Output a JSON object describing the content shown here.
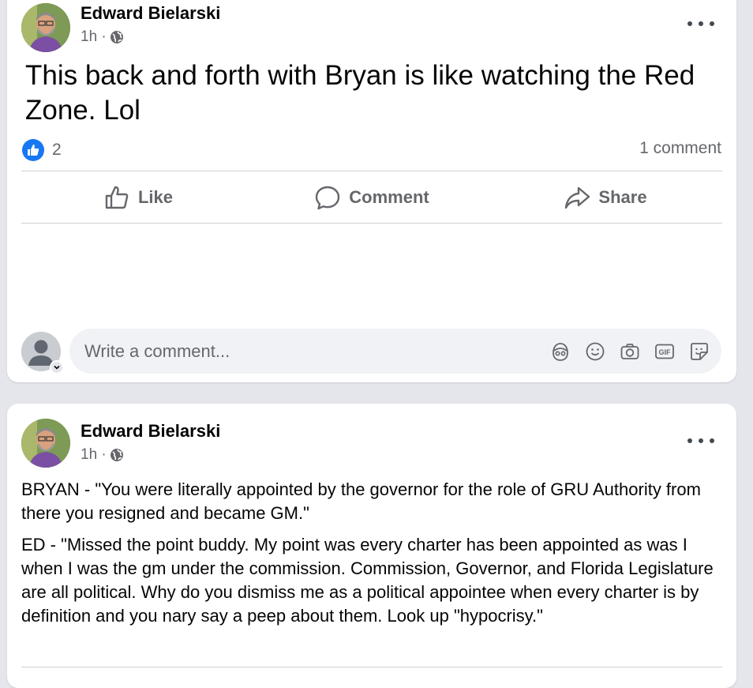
{
  "post1": {
    "author": "Edward Bielarski",
    "time": "1h ·",
    "text": "This back and forth with Bryan is like watching the Red Zone. Lol",
    "reaction_count": "2",
    "comment_count": "1 comment",
    "actions": {
      "like": "Like",
      "comment": "Comment",
      "share": "Share"
    },
    "comment_placeholder": "Write a comment..."
  },
  "post2": {
    "author": "Edward Bielarski",
    "time": "1h ·",
    "paragraph1": "BRYAN - \"You were literally appointed by the governor for the role of GRU Authority from there you resigned and became GM.\"",
    "paragraph2": "ED - \"Missed the point buddy.  My point was every charter has been appointed as was I when I was the gm under the commission. Commission, Governor, and Florida Legislature are all political.  Why do you dismiss me as a political appointee when every charter is by definition and you nary say a peep about them.  Look up \"hypocrisy.\""
  },
  "icons": [
    "globe-icon",
    "more-options-icon",
    "like-reaction-icon",
    "thumbs-up-icon",
    "comment-bubble-icon",
    "share-arrow-icon",
    "avatar-icon",
    "chevron-down-icon",
    "avatar-sticker-icon",
    "emoji-icon",
    "camera-icon",
    "gif-icon",
    "sticker-icon"
  ],
  "colors": {
    "accent": "#1877f2",
    "muted": "#65676b",
    "background": "#e4e6eb",
    "divider": "#ced0d4"
  }
}
